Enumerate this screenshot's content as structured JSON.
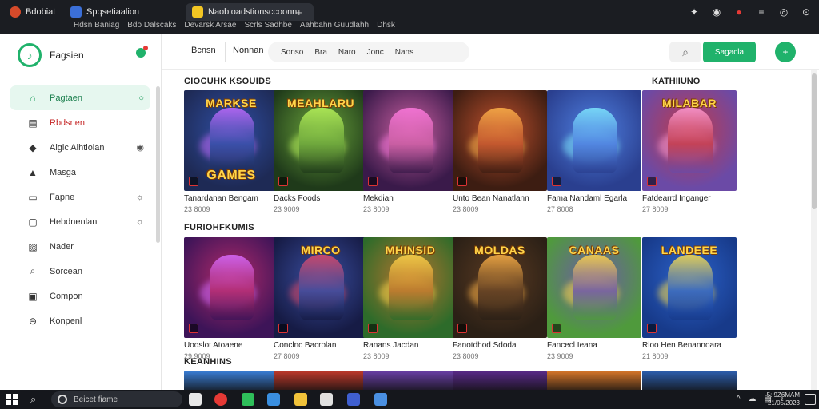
{
  "browser": {
    "tabs": [
      {
        "label": "Bdobiat",
        "color": "#d64a2a"
      },
      {
        "label": "Spqsetiaalion",
        "color": "#3b6fd8"
      },
      {
        "label": "Naobloadstionsccoonn",
        "color": "#f3c623"
      }
    ],
    "new_tab": "+",
    "bookmarks": [
      "Hdsn Baniag",
      "Bdo Dalscaks",
      "Devarsk Arsae",
      "Scrls Sadhbe",
      "Aahbahn Guudlahh",
      "Dhsk"
    ],
    "controls": [
      "puzzle-icon",
      "extension-icon",
      "red-icon",
      "menu-icon",
      "record-icon",
      "profile-icon"
    ]
  },
  "sidebar": {
    "brand": "Fagsien",
    "items": [
      {
        "label": "Pagtaen",
        "icon": "⌂",
        "trail": "○",
        "active": true
      },
      {
        "label": "Rbdsnen",
        "icon": "▤",
        "red": true
      },
      {
        "label": "Algic Aihtiolan",
        "icon": "◆",
        "trail": "◉"
      },
      {
        "label": "Masga",
        "icon": "▲"
      },
      {
        "label": "Fapne",
        "icon": "▭",
        "trail": "☼"
      },
      {
        "label": "Hebdnenlan",
        "icon": "▢",
        "trail": "☼"
      },
      {
        "label": "Nader",
        "icon": "▨"
      },
      {
        "label": "Sorcean",
        "icon": "⌕"
      },
      {
        "label": "Compon",
        "icon": "▣"
      },
      {
        "label": "Konpenl",
        "icon": "⊖"
      }
    ]
  },
  "header": {
    "btn1": "Bcnsn",
    "btn2": "Nonnan",
    "filters": [
      "Sonso",
      "Bra",
      "Naro",
      "Jonc",
      "Nans"
    ],
    "search_icon": "search-icon",
    "primary": "Sagacla",
    "fab": "+"
  },
  "sections": [
    {
      "title": "CIOCUHK KSOUIDS",
      "right_title": "KATHIIUNO",
      "cards": [
        {
          "title": "Tanardanan Bengam",
          "meta": "23 8009",
          "logo": "MARKSE",
          "logo2": "GAMES",
          "bg": "#1e2a55",
          "hero": "#2f4ea3",
          "glow": "#c26bff"
        },
        {
          "title": "Dacks Foods",
          "meta": "23 9009",
          "logo": "MEAHLARU",
          "bg": "#1f3a1a",
          "hero": "#6aa33b",
          "glow": "#b9f55b"
        },
        {
          "title": "Mekdian",
          "meta": "23 8009",
          "logo": "",
          "bg": "#3a1a4a",
          "hero": "#c85ea0",
          "glow": "#ff7adf"
        },
        {
          "title": "Unto Bean Nanatlann",
          "meta": "23 8009",
          "logo": "",
          "bg": "#3d1d12",
          "hero": "#c0512d",
          "glow": "#ffb34a"
        },
        {
          "title": "Fama Nandaml Egarla",
          "meta": "27 8008",
          "logo": "",
          "bg": "#2a3f8f",
          "hero": "#4f7fe0",
          "glow": "#7fe8ff"
        },
        {
          "title": "Fatdearrd Inganger",
          "meta": "27 8009",
          "logo": "MILABAR",
          "bg": "#6b4aa6",
          "hero": "#c03a4b",
          "glow": "#ff9bd2"
        }
      ]
    },
    {
      "title": "FURIOHFKUMIS",
      "cards": [
        {
          "title": "Uooslot Atoaene",
          "meta": "29 9009",
          "logo": "",
          "bg": "#3d1458",
          "hero": "#b12a6a",
          "glow": "#d86bff"
        },
        {
          "title": "Conclnc Bacrolan",
          "meta": "27 8009",
          "logo": "MIRCO",
          "bg": "#161b45",
          "hero": "#3a4ea0",
          "glow": "#e04a6a"
        },
        {
          "title": "Ranans Jacdan",
          "meta": "23 8009",
          "logo": "MHINSID",
          "bg": "#2d6b2a",
          "hero": "#b8742d",
          "glow": "#ffd54a"
        },
        {
          "title": "Fanotdhod Sdoda",
          "meta": "23 8009",
          "logo": "MOLDAS",
          "bg": "#2b2016",
          "hero": "#5a3a22",
          "glow": "#ffb347"
        },
        {
          "title": "Fancecl Ieana",
          "meta": "23 9009",
          "logo": "CANAAS",
          "bg": "#4f9a3c",
          "hero": "#6e5aa8",
          "glow": "#ffd54a"
        },
        {
          "title": "Rloo Hen Benannoara",
          "meta": "21 8009",
          "logo": "LANDEEE",
          "bg": "#173a8a",
          "hero": "#2c62c9",
          "glow": "#ffe14a"
        }
      ]
    },
    {
      "title": "KEANHINS",
      "strips": [
        "#3a7fd8",
        "#c0392b",
        "#6a3fa8",
        "#5a2a8a",
        "#d9772a",
        "#2d5fb0"
      ]
    }
  ],
  "taskbar": {
    "search": "Beicet fiame",
    "apps": [
      "#e7e7e7",
      "#e53935",
      "#2fbf5a",
      "#3a8fe0",
      "#f0c23a",
      "#e0e0e0",
      "#3f5fd0",
      "#4a8fe0"
    ],
    "tray": [
      "^",
      "☁",
      "▤",
      "♪"
    ],
    "clock_line1": "5: 9Z6MAM",
    "clock_line2": "21/05/2023"
  },
  "colors": {
    "accent": "#20b26b"
  }
}
